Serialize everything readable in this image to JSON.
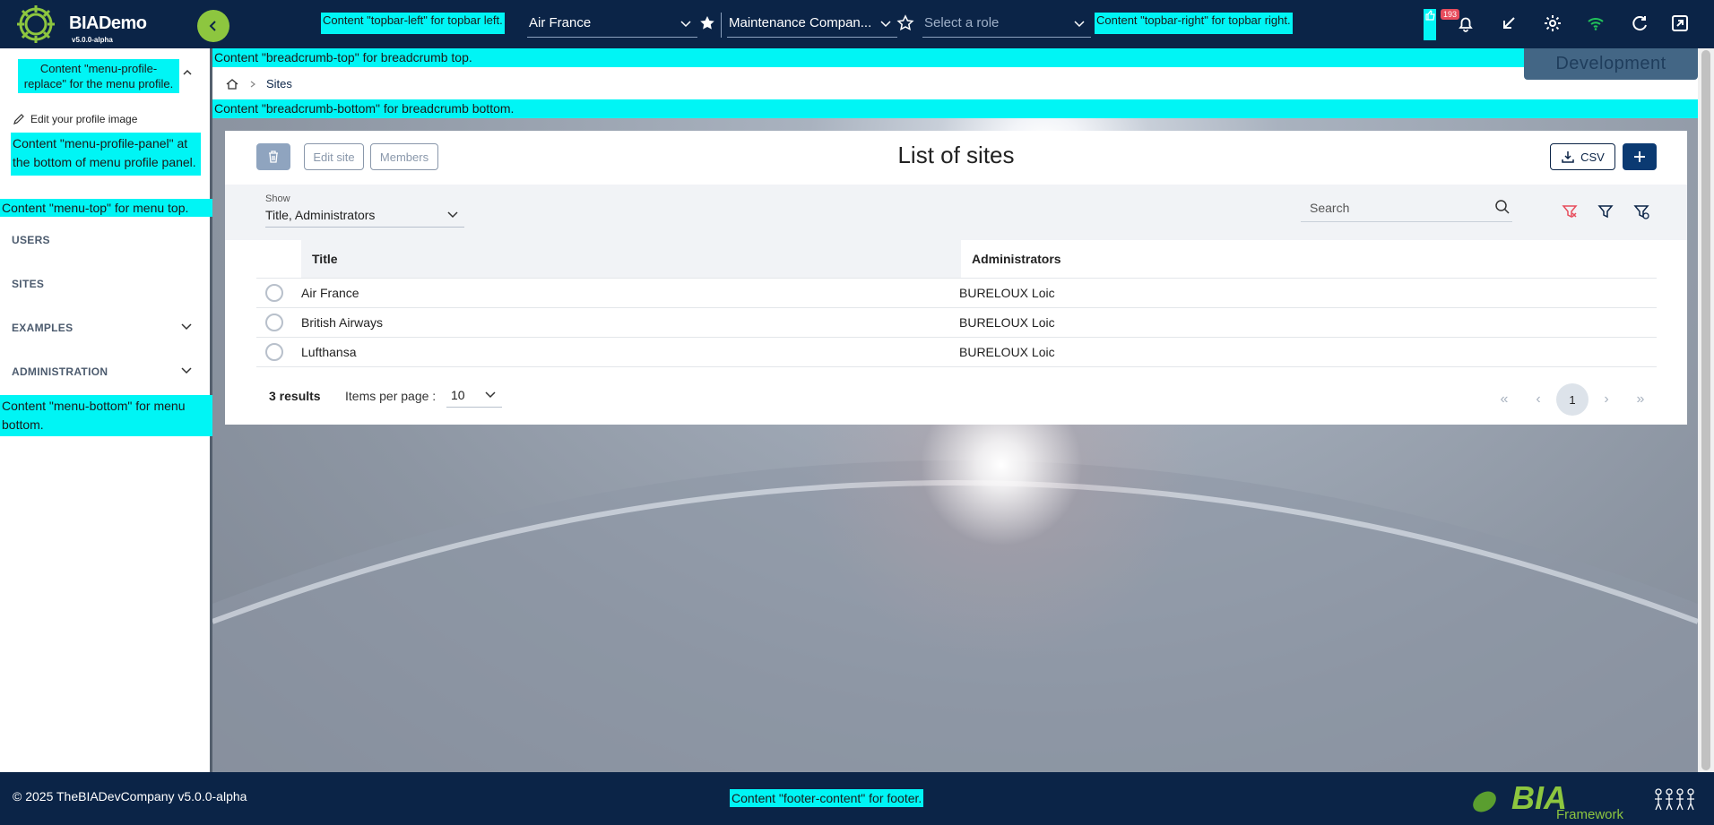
{
  "app": {
    "name": "BIADemo",
    "version": "v5.0.0-alpha"
  },
  "topbar": {
    "left_placeholder": "Content \"topbar-left\" for topbar left.",
    "site_select": "Air France",
    "team_select": "Maintenance Compan...",
    "role_placeholder": "Select a role",
    "right_placeholder": "Content \"topbar-right\" for topbar right.",
    "notification_count": "193",
    "icons": [
      "thumb-icon",
      "bell-icon",
      "arrow-down-left-icon",
      "gear-icon",
      "wifi-icon",
      "refresh-icon",
      "fullscreen-icon"
    ]
  },
  "sidebar": {
    "profile_replace": "Content \"menu-profile-replace\" for the menu profile.",
    "edit_profile_image": "Edit your profile image",
    "profile_panel": "Content \"menu-profile-panel\" at the bottom of menu profile panel.",
    "menu_top": "Content \"menu-top\" for menu top.",
    "items": [
      {
        "label": "USERS",
        "expandable": false
      },
      {
        "label": "SITES",
        "expandable": false
      },
      {
        "label": "EXAMPLES",
        "expandable": true
      },
      {
        "label": "ADMINISTRATION",
        "expandable": true
      }
    ],
    "menu_bottom": "Content \"menu-bottom\" for menu bottom."
  },
  "breadcrumb": {
    "top": "Content \"breadcrumb-top\" for breadcrumb top.",
    "current": "Sites",
    "bottom": "Content \"breadcrumb-bottom\" for breadcrumb bottom."
  },
  "environment_badge": "Development",
  "page": {
    "title": "List of sites",
    "edit_site_label": "Edit site",
    "members_label": "Members",
    "csv_label": "CSV",
    "show_label": "Show",
    "show_value": "Title, Administrators",
    "search_placeholder": "Search"
  },
  "table": {
    "columns": [
      "Title",
      "Administrators"
    ],
    "rows": [
      {
        "title": "Air France",
        "administrators": "BURELOUX Loic"
      },
      {
        "title": "British Airways",
        "administrators": "BURELOUX Loic"
      },
      {
        "title": "Lufthansa",
        "administrators": "BURELOUX Loic"
      }
    ]
  },
  "pagination": {
    "results": "3 results",
    "items_per_page_label": "Items per page :",
    "items_per_page": "10",
    "current_page": "1"
  },
  "footer": {
    "copyright": "© 2025 TheBIADevCompany v5.0.0-alpha",
    "content": "Content \"footer-content\" for footer.",
    "logo_text": "BIA",
    "logo_subtext": "Framework"
  },
  "colors": {
    "topbar": "#0b2447",
    "accent_green": "#8dc63f",
    "cyan_placeholder": "#00f5f5",
    "primary_button": "#0b3a72"
  }
}
